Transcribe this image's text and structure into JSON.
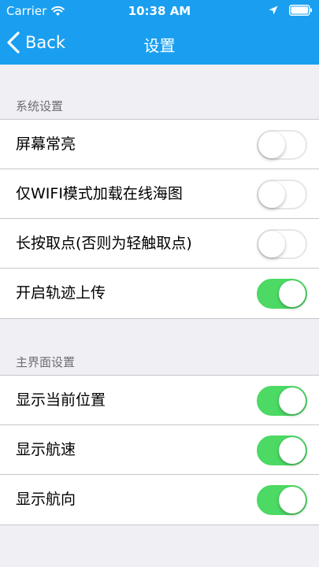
{
  "status_bar": {
    "carrier": "Carrier",
    "time": "10:38 AM",
    "icons": [
      "wifi-icon",
      "location-icon",
      "battery-icon"
    ]
  },
  "nav": {
    "back_label": "Back",
    "title": "设置"
  },
  "colors": {
    "nav_background": "#1a9ff0",
    "toggle_on": "#4cd964",
    "page_background": "#efeff4"
  },
  "sections": [
    {
      "header": "系统设置",
      "items": [
        {
          "label": "屏幕常亮",
          "on": false
        },
        {
          "label": "仅WIFI模式加载在线海图",
          "on": false
        },
        {
          "label": "长按取点(否则为轻触取点)",
          "on": false
        },
        {
          "label": "开启轨迹上传",
          "on": true
        }
      ]
    },
    {
      "header": "主界面设置",
      "items": [
        {
          "label": "显示当前位置",
          "on": true
        },
        {
          "label": "显示航速",
          "on": true
        },
        {
          "label": "显示航向",
          "on": true
        }
      ]
    }
  ]
}
